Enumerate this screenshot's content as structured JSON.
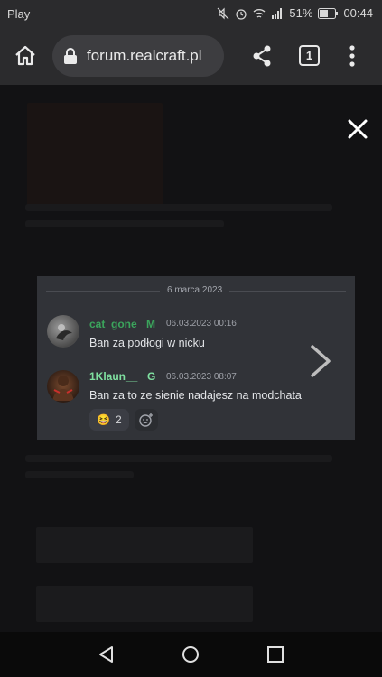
{
  "status_bar": {
    "carrier": "Play",
    "battery": "51%",
    "time": "00:44"
  },
  "browser": {
    "url": "forum.realcraft.pl",
    "tab_count": "1"
  },
  "chat": {
    "date": "6 marca 2023",
    "messages": [
      {
        "author": "cat_gone",
        "badge": "M",
        "author_color": "#3ba55c",
        "time": "06.03.2023 00:16",
        "text": "Ban za podłogi w nicku"
      },
      {
        "author": "1Klaun__",
        "badge": "G",
        "author_color": "#7fe0a0",
        "time": "06.03.2023 08:07",
        "text": "Ban za to ze sienie nadajesz na modchata",
        "reaction": {
          "emoji": "😆",
          "count": "2"
        }
      }
    ]
  }
}
